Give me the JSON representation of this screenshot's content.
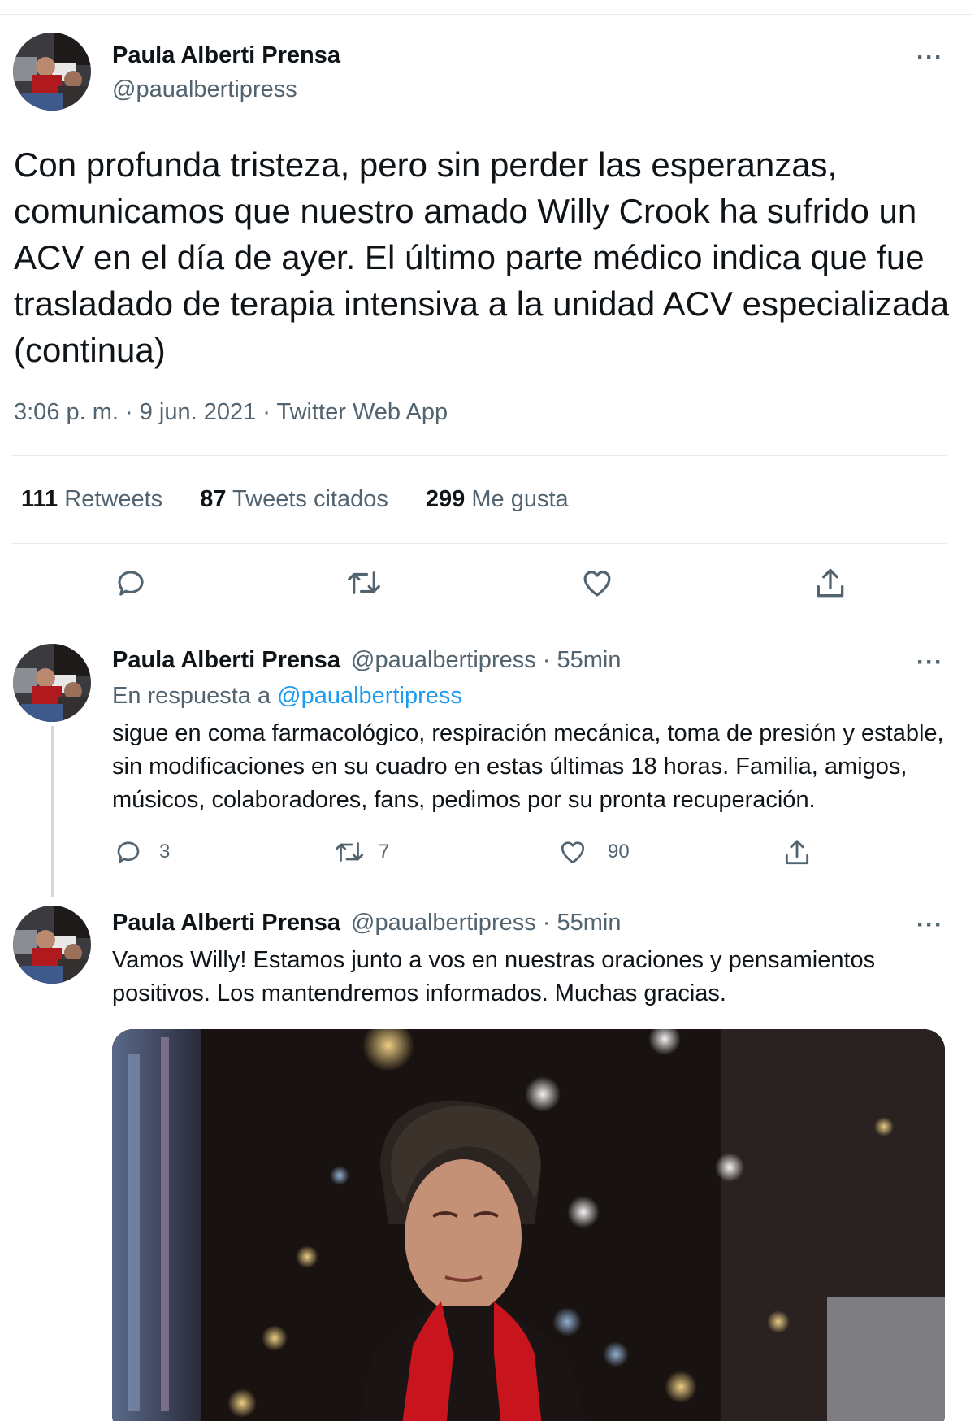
{
  "main_tweet": {
    "author_name": "Paula Alberti Prensa",
    "handle": "@paualbertipress",
    "more": "···",
    "text": "Con profunda tristeza, pero sin perder las esperanzas, comunicamos que nuestro amado Willy Crook ha sufrido un ACV en el día de ayer. El último parte médico indica que fue trasladado de terapia intensiva a la unidad ACV especializada (continua)",
    "meta": "3:06 p. m. · 9 jun. 2021 · Twitter Web App",
    "stats": [
      {
        "count": "111",
        "label": "Retweets"
      },
      {
        "count": "87",
        "label": "Tweets citados"
      },
      {
        "count": "299",
        "label": "Me gusta"
      }
    ]
  },
  "reply_1": {
    "author_name": "Paula Alberti Prensa",
    "handle_time": "@paualbertipress · 55min",
    "more": "···",
    "reply_prefix": "En respuesta a ",
    "reply_handle": "@paualbertipress",
    "text": "sigue en coma farmacológico, respiración mecánica, toma de presión y estable, sin modificaciones en su cuadro en estas últimas 18 horas. Familia, amigos, músicos, colaboradores, fans, pedimos por su pronta recuperación.",
    "replies": "3",
    "retweets": "7",
    "likes": "90"
  },
  "reply_2": {
    "author_name": "Paula Alberti Prensa",
    "handle_time": "@paualbertipress · 55min",
    "more": "···",
    "text": "Vamos Willy! Estamos junto a vos en nuestras oraciones y pensamientos positivos. Los mantendremos informados. Muchas gracias."
  },
  "icons": [
    "reply-icon",
    "retweet-icon",
    "like-icon",
    "share-icon"
  ],
  "colors": {
    "text": "#0f1419",
    "secondary": "#536471",
    "link": "#1d9bf0",
    "border": "#e6ecf0",
    "scarf": "#c8141c"
  }
}
